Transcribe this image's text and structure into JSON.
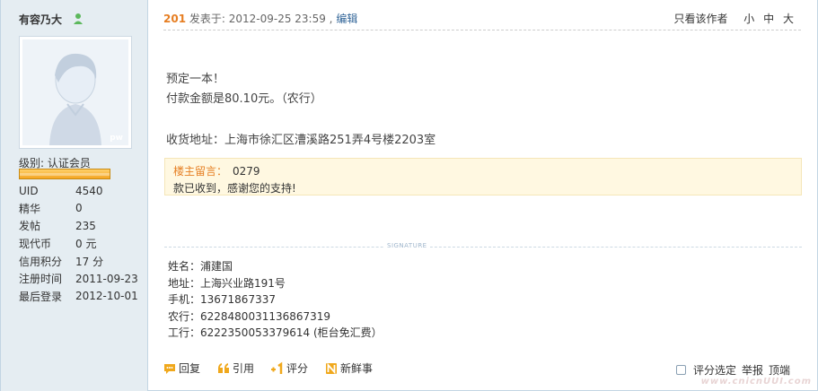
{
  "user": {
    "name": "有容乃大",
    "level_label": "级别: 认证会员",
    "stats": [
      {
        "key": "UID",
        "value": "4540"
      },
      {
        "key": "精华",
        "value": "0"
      },
      {
        "key": "发帖",
        "value": "235"
      },
      {
        "key": "现代币",
        "value": "0 元"
      },
      {
        "key": "信用积分",
        "value": "17 分"
      },
      {
        "key": "注册时间",
        "value": "2011-09-23"
      },
      {
        "key": "最后登录",
        "value": "2012-10-01"
      }
    ],
    "avatar_badge": "pw"
  },
  "post": {
    "floor": "201",
    "meta": " 发表于: 2012-09-25 23:59 , ",
    "edit": "编辑",
    "view_author": "只看该作者",
    "font_small": "小",
    "font_medium": "中",
    "font_large": "大",
    "lines": [
      "预定一本！",
      "付款金额是80.10元。（农行）"
    ],
    "address": "收货地址：上海市徐汇区漕溪路251弄4号楼2203室",
    "owner_note": {
      "label": "楼主留言：",
      "code": "0279",
      "text": "款已收到，感谢您的支持!"
    }
  },
  "signature": {
    "label": "SIGNATURE",
    "rows": [
      "姓名：浦建国",
      "地址：上海兴业路191号",
      "手机：13671867337",
      "农行：6228480031136867319",
      "工行：6222350053379614 (柜台免汇费）"
    ]
  },
  "toolbar": {
    "reply": "回复",
    "quote": "引用",
    "rate": "评分",
    "fresh": "新鲜事",
    "rate_select": "评分选定",
    "report": "举报",
    "top": "顶端"
  },
  "watermark": "www.cnicnUUI.com",
  "colors": {
    "floor": "#e67e22",
    "note_bg": "#fff8e1",
    "sidebar_bg": "#e5edf2"
  }
}
